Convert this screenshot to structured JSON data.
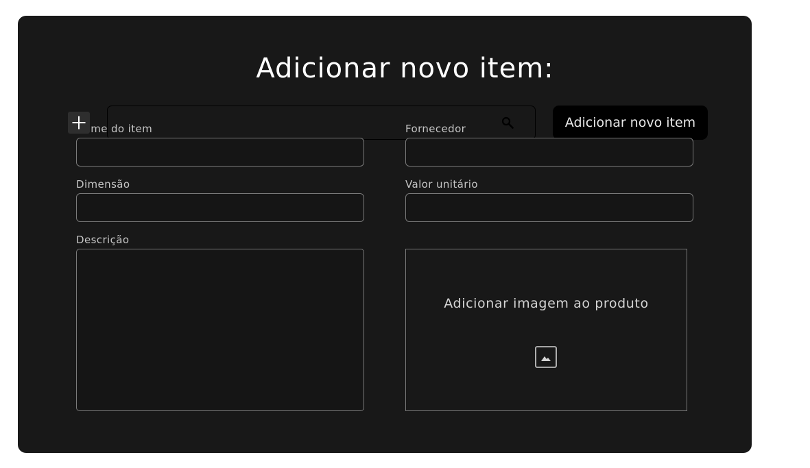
{
  "page": {
    "title": "Adicionar novo item:"
  },
  "toolbar": {
    "search_icon": "search-icon",
    "add_button_label": "Adicionar novo item",
    "plus_icon": "plus-icon"
  },
  "form": {
    "nome": {
      "label": "Nome do item",
      "value": ""
    },
    "fornecedor": {
      "label": "Fornecedor",
      "value": ""
    },
    "dimensao": {
      "label": "Dimensão",
      "value": ""
    },
    "valor": {
      "label": "Valor unitário",
      "value": ""
    },
    "descricao": {
      "label": "Descrição",
      "value": ""
    },
    "imagem": {
      "label": "Adicionar imagem ao produto",
      "icon": "image-icon"
    }
  },
  "colors": {
    "modal_background": "#181818",
    "page_background": "#ffffff",
    "button_background": "#000000",
    "field_border": "#7a7a7a",
    "text": "#ffffff"
  }
}
